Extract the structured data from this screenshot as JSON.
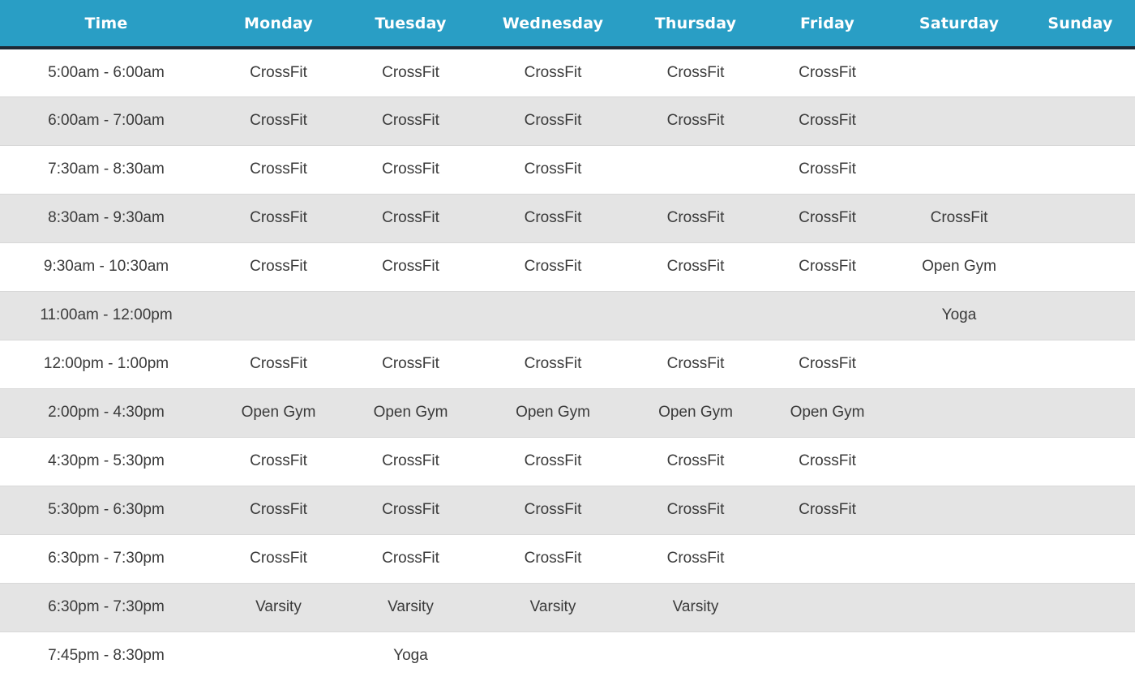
{
  "schedule": {
    "headers": [
      "Time",
      "Monday",
      "Tuesday",
      "Wednesday",
      "Thursday",
      "Friday",
      "Saturday",
      "Sunday"
    ],
    "rows": [
      [
        "5:00am - 6:00am",
        "CrossFit",
        "CrossFit",
        "CrossFit",
        "CrossFit",
        "CrossFit",
        "",
        ""
      ],
      [
        "6:00am - 7:00am",
        "CrossFit",
        "CrossFit",
        "CrossFit",
        "CrossFit",
        "CrossFit",
        "",
        ""
      ],
      [
        "7:30am - 8:30am",
        "CrossFit",
        "CrossFit",
        "CrossFit",
        "",
        "CrossFit",
        "",
        ""
      ],
      [
        "8:30am - 9:30am",
        "CrossFit",
        "CrossFit",
        "CrossFit",
        "CrossFit",
        "CrossFit",
        "CrossFit",
        ""
      ],
      [
        "9:30am - 10:30am",
        "CrossFit",
        "CrossFit",
        "CrossFit",
        "CrossFit",
        "CrossFit",
        "Open Gym",
        ""
      ],
      [
        "11:00am - 12:00pm",
        "",
        "",
        "",
        "",
        "",
        "Yoga",
        ""
      ],
      [
        "12:00pm - 1:00pm",
        "CrossFit",
        "CrossFit",
        "CrossFit",
        "CrossFit",
        "CrossFit",
        "",
        ""
      ],
      [
        "2:00pm - 4:30pm",
        "Open Gym",
        "Open Gym",
        "Open Gym",
        "Open Gym",
        "Open Gym",
        "",
        ""
      ],
      [
        "4:30pm - 5:30pm",
        "CrossFit",
        "CrossFit",
        "CrossFit",
        "CrossFit",
        "CrossFit",
        "",
        ""
      ],
      [
        "5:30pm - 6:30pm",
        "CrossFit",
        "CrossFit",
        "CrossFit",
        "CrossFit",
        "CrossFit",
        "",
        ""
      ],
      [
        "6:30pm - 7:30pm",
        "CrossFit",
        "CrossFit",
        "CrossFit",
        "CrossFit",
        "",
        "",
        ""
      ],
      [
        "6:30pm - 7:30pm",
        "Varsity",
        "Varsity",
        "Varsity",
        "Varsity",
        "",
        "",
        ""
      ],
      [
        "7:45pm - 8:30pm",
        "",
        "Yoga",
        "",
        "",
        "",
        "",
        ""
      ]
    ]
  },
  "colors": {
    "header_bg": "#299ec5",
    "header_border": "#1e2935",
    "row_alt_bg": "#e4e4e4"
  }
}
